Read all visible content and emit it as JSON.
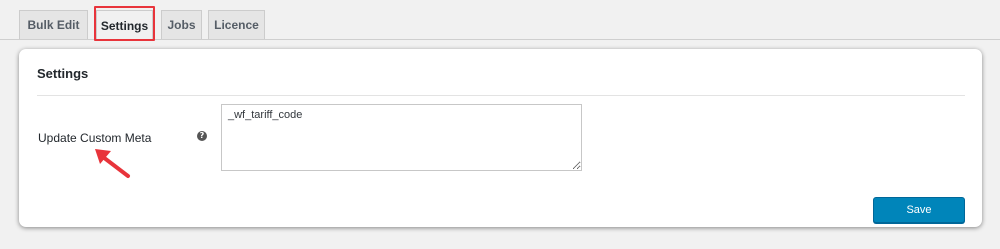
{
  "tabs": [
    {
      "label": "Bulk Edit",
      "active": false
    },
    {
      "label": "Settings",
      "active": true
    },
    {
      "label": "Jobs",
      "active": false
    },
    {
      "label": "Licence",
      "active": false
    }
  ],
  "settings": {
    "title": "Settings",
    "field_label": "Update Custom Meta",
    "help_icon": "question-circle-icon",
    "meta_value": "_wf_tariff_code",
    "save_label": "Save"
  },
  "colors": {
    "highlight": "#e8343b",
    "primary_button": "#0085ba",
    "background": "#f1f1f1"
  }
}
